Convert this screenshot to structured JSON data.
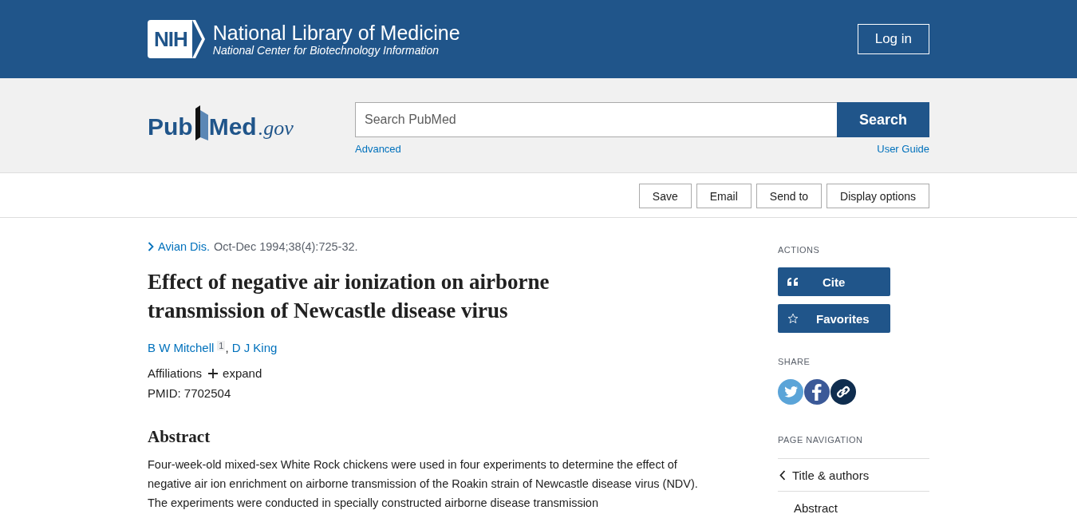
{
  "header": {
    "logo_text": "NIH",
    "title": "National Library of Medicine",
    "subtitle": "National Center for Biotechnology Information",
    "login_button": "Log in"
  },
  "search": {
    "logo": {
      "part_1": "Pub",
      "part_2": "Med",
      "suffix": ".gov"
    },
    "placeholder": "Search PubMed",
    "button": "Search",
    "advanced_link": "Advanced",
    "guide_link": "User Guide"
  },
  "toolbar": {
    "buttons": [
      "Save",
      "Email",
      "Send to",
      "Display options"
    ]
  },
  "article": {
    "journal": "Avian Dis.",
    "citation": "Oct-Dec 1994;38(4):725-32.",
    "title": "Effect of negative air ionization on airborne transmission of Newcastle disease virus",
    "authors": [
      {
        "name": "B W Mitchell",
        "affiliation_mark": "1",
        "separator": ","
      },
      {
        "name": "D J King"
      }
    ],
    "affiliations_label": "Affiliations",
    "expand_label": "expand",
    "pmid": "PMID: 7702504",
    "abstract_heading": "Abstract",
    "abstract_text": "Four-week-old mixed-sex White Rock chickens were used in four experiments to determine the effect of negative air ion enrichment on airborne transmission of the Roakin strain of Newcastle disease virus (NDV). The experiments were conducted in specially constructed airborne disease transmission"
  },
  "sidebar": {
    "actions_heading": "ACTIONS",
    "action_buttons": [
      {
        "kind": "cite",
        "label": "Cite"
      },
      {
        "kind": "favorites",
        "label": "Favorites"
      }
    ],
    "share_heading": "SHARE",
    "share_links": [
      {
        "kind": "twitter"
      },
      {
        "kind": "facebook"
      },
      {
        "kind": "link"
      }
    ],
    "nav_heading": "PAGE NAVIGATION",
    "nav_items": [
      {
        "label": "Title & authors",
        "selected": true
      },
      {
        "label": "Abstract",
        "selected": false
      }
    ]
  }
}
